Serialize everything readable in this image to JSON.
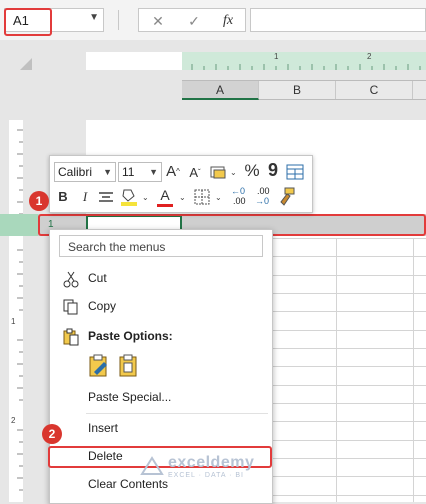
{
  "formula_bar": {
    "name_box": "A1",
    "cancel_symbol": "✕",
    "enter_symbol": "✓",
    "fx_symbol": "fx",
    "formula_value": ""
  },
  "ruler": {
    "top_numbers": [
      "1",
      "2"
    ],
    "left_numbers": [
      "1",
      "2"
    ]
  },
  "columns": [
    "A",
    "B",
    "C"
  ],
  "row_number": "1",
  "mini_toolbar": {
    "font_name": "Calibri",
    "font_size": "11",
    "grow_font": "A",
    "shrink_font": "A",
    "bold": "B",
    "italic": "I",
    "percent": "%",
    "comma": "9",
    "font_color_letter": "A",
    "decrease_decimal": ".00",
    "increase_decimal": ".00"
  },
  "context_menu": {
    "search_placeholder": "Search the menus",
    "cut": "Cut",
    "copy": "Copy",
    "paste_options": "Paste Options:",
    "paste_special": "Paste Special...",
    "insert": "Insert",
    "delete": "Delete",
    "clear_contents": "Clear Contents"
  },
  "badges": [
    "1",
    "2"
  ],
  "watermark": {
    "name": "exceldemy",
    "subtitle": "EXCEL · DATA · BI"
  },
  "colors": {
    "excel_green": "#217346",
    "highlight_red": "#e23b3b",
    "badge_red": "#d9362e"
  }
}
